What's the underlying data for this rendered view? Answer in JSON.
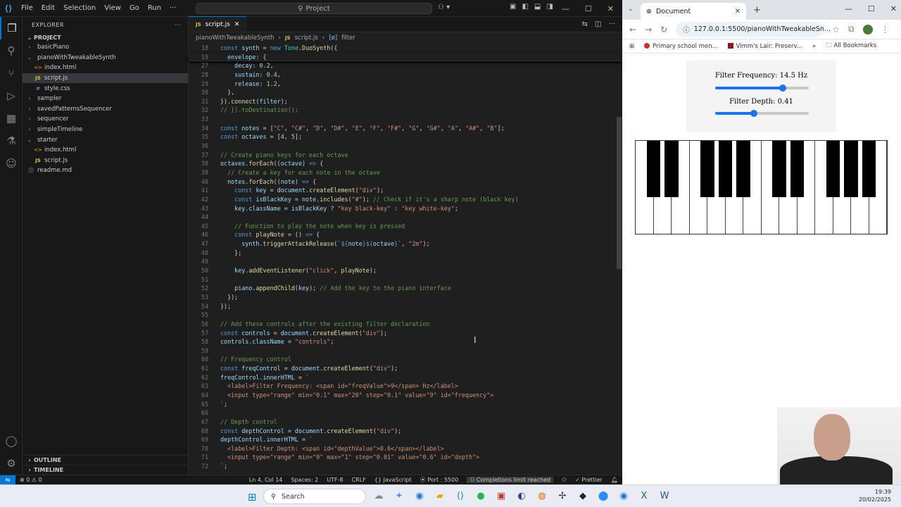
{
  "vscode": {
    "menu": [
      "File",
      "Edit",
      "Selection",
      "View",
      "Go",
      "Run",
      "···"
    ],
    "command_center": "Project",
    "explorer_title": "EXPLORER",
    "project_label": "PROJECT",
    "tree": [
      {
        "label": "basicPiano",
        "type": "folder",
        "depth": 1
      },
      {
        "label": "pianoWithTweakableSynth",
        "type": "folder-open",
        "depth": 1
      },
      {
        "label": "index.html",
        "type": "html",
        "depth": 2
      },
      {
        "label": "script.js",
        "type": "js",
        "depth": 2
      },
      {
        "label": "style.css",
        "type": "css",
        "depth": 2
      },
      {
        "label": "sampler",
        "type": "folder",
        "depth": 1
      },
      {
        "label": "savedPatternsSequencer",
        "type": "folder",
        "depth": 1
      },
      {
        "label": "sequencer",
        "type": "folder",
        "depth": 1
      },
      {
        "label": "simpleTimeline",
        "type": "folder",
        "depth": 1
      },
      {
        "label": "starter",
        "type": "folder-open",
        "depth": 1
      },
      {
        "label": "index.html",
        "type": "html",
        "depth": 2
      },
      {
        "label": "script.js",
        "type": "js",
        "depth": 2
      },
      {
        "label": "readme.md",
        "type": "md",
        "depth": 1
      }
    ],
    "outline_label": "OUTLINE",
    "timeline_label": "TIMELINE",
    "tab_label": "script.js",
    "breadcrumb": [
      "pianoWithTweakableSynth",
      "script.js",
      "filter"
    ],
    "code_lines": [
      {
        "n": "18",
        "html": "<span class='k'>const</span> <span class='v'>synth</span> = <span class='k'>new</span> <span class='cl'>Tone</span>.<span class='f'>DuoSynth</span>({",
        "sticky": true
      },
      {
        "n": "19",
        "html": "  <span class='v'>envelope</span>: {",
        "sticky": true
      },
      {
        "n": "27",
        "html": "    <span class='v'>decay</span>: <span class='n'>0.2</span>,"
      },
      {
        "n": "28",
        "html": "    <span class='v'>sustain</span>: <span class='n'>0.4</span>,"
      },
      {
        "n": "29",
        "html": "    <span class='v'>release</span>: <span class='n'>1.2</span>,"
      },
      {
        "n": "30",
        "html": "  },"
      },
      {
        "n": "31",
        "html": "}).<span class='f'>connect</span>(<span class='v'>filter</span>);"
      },
      {
        "n": "32",
        "html": "<span class='c'>// }).toDestination();</span>"
      },
      {
        "n": "33",
        "html": ""
      },
      {
        "n": "34",
        "html": "<span class='k'>const</span> <span class='v'>notes</span> = [<span class='s'>\"C\"</span>, <span class='s'>\"C#\"</span>, <span class='s'>\"D\"</span>, <span class='s'>\"D#\"</span>, <span class='s'>\"E\"</span>, <span class='s'>\"F\"</span>, <span class='s'>\"F#\"</span>, <span class='s'>\"G\"</span>, <span class='s'>\"G#\"</span>, <span class='s'>\"A\"</span>, <span class='s'>\"A#\"</span>, <span class='s'>\"B\"</span>];"
      },
      {
        "n": "35",
        "html": "<span class='k'>const</span> <span class='v'>octaves</span> = [<span class='n'>4</span>, <span class='n'>5</span>];"
      },
      {
        "n": "36",
        "html": ""
      },
      {
        "n": "37",
        "html": "<span class='c'>// Create piano keys for each octave</span>"
      },
      {
        "n": "38",
        "html": "<span class='v'>octaves</span>.<span class='f'>forEach</span>((<span class='v'>octave</span>) <span class='k'>=&gt;</span> {"
      },
      {
        "n": "39",
        "html": "  <span class='c'>// Create a key for each note in the octave</span>"
      },
      {
        "n": "40",
        "html": "  <span class='v'>notes</span>.<span class='f'>forEach</span>((<span class='v'>note</span>) <span class='k'>=&gt;</span> {"
      },
      {
        "n": "41",
        "html": "    <span class='k'>const</span> <span class='v'>key</span> = <span class='v'>document</span>.<span class='f'>createElement</span>(<span class='s'>\"div\"</span>);"
      },
      {
        "n": "42",
        "html": "    <span class='k'>const</span> <span class='v'>isBlackKey</span> = <span class='v'>note</span>.<span class='f'>includes</span>(<span class='s'>\"#\"</span>); <span class='c'>// Check if it's a sharp note (black key)</span>"
      },
      {
        "n": "43",
        "html": "    <span class='v'>key</span>.<span class='v'>className</span> = <span class='v'>isBlackKey</span> ? <span class='s'>\"key black-key\"</span> : <span class='s'>\"key white-key\"</span>;"
      },
      {
        "n": "44",
        "html": ""
      },
      {
        "n": "45",
        "html": "    <span class='c'>// Function to play the note when key is pressed</span>"
      },
      {
        "n": "46",
        "html": "    <span class='k'>const</span> <span class='f'>playNote</span> = () <span class='k'>=&gt;</span> {"
      },
      {
        "n": "47",
        "html": "      <span class='v'>synth</span>.<span class='f'>triggerAttackRelease</span>(<span class='s'>`</span><span class='k'>${</span><span class='v'>note</span><span class='k'>}${</span><span class='v'>octave</span><span class='k'>}</span><span class='s'>`</span>, <span class='s'>\"2m\"</span>);"
      },
      {
        "n": "48",
        "html": "    };"
      },
      {
        "n": "49",
        "html": ""
      },
      {
        "n": "50",
        "html": "    <span class='v'>key</span>.<span class='f'>addEventListener</span>(<span class='s'>\"click\"</span>, <span class='f'>playNote</span>);"
      },
      {
        "n": "51",
        "html": ""
      },
      {
        "n": "52",
        "html": "    <span class='v'>piano</span>.<span class='f'>appendChild</span>(<span class='v'>key</span>); <span class='c'>// Add the key to the piano interface</span>"
      },
      {
        "n": "53",
        "html": "  });"
      },
      {
        "n": "54",
        "html": "});"
      },
      {
        "n": "55",
        "html": ""
      },
      {
        "n": "56",
        "html": "<span class='c'>// Add these controls after the existing filter declaration</span>"
      },
      {
        "n": "57",
        "html": "<span class='k'>const</span> <span class='v'>controls</span> = <span class='v'>document</span>.<span class='f'>createElement</span>(<span class='s'>\"div\"</span>);"
      },
      {
        "n": "58",
        "html": "<span class='v'>controls</span>.<span class='v'>className</span> = <span class='s'>\"controls\"</span>;"
      },
      {
        "n": "59",
        "html": ""
      },
      {
        "n": "60",
        "html": "<span class='c'>// Frequency control</span>"
      },
      {
        "n": "61",
        "html": "<span class='k'>const</span> <span class='v'>freqControl</span> = <span class='v'>document</span>.<span class='f'>createElement</span>(<span class='s'>\"div\"</span>);"
      },
      {
        "n": "62",
        "html": "<span class='v'>freqControl</span>.<span class='v'>innerHTML</span> = <span class='s'>`</span>"
      },
      {
        "n": "63",
        "html": "<span class='s'>  &lt;label&gt;Filter Frequency: &lt;span id=\"freqValue\"&gt;9&lt;/span&gt; Hz&lt;/label&gt;</span>"
      },
      {
        "n": "64",
        "html": "<span class='s'>  &lt;input type=\"range\" min=\"0.1\" max=\"20\" step=\"0.1\" value=\"9\" id=\"frequency\"&gt;</span>"
      },
      {
        "n": "65",
        "html": "<span class='s'>`</span>;"
      },
      {
        "n": "66",
        "html": ""
      },
      {
        "n": "67",
        "html": "<span class='c'>// Depth control</span>"
      },
      {
        "n": "68",
        "html": "<span class='k'>const</span> <span class='v'>depthControl</span> = <span class='v'>document</span>.<span class='f'>createElement</span>(<span class='s'>\"div\"</span>);"
      },
      {
        "n": "69",
        "html": "<span class='v'>depthControl</span>.<span class='v'>innerHTML</span> = <span class='s'>`</span>"
      },
      {
        "n": "70",
        "html": "<span class='s'>  &lt;label&gt;Filter Depth: &lt;span id=\"depthValue\"&gt;0.6&lt;/span&gt;&lt;/label&gt;</span>"
      },
      {
        "n": "71",
        "html": "<span class='s'>  &lt;input type=\"range\" min=\"0\" max=\"1\" step=\"0.01\" value=\"0.6\" id=\"depth\"&gt;</span>"
      },
      {
        "n": "72",
        "html": "<span class='s'>`</span>;"
      }
    ],
    "status": {
      "errors": "⊗ 0 ⚠ 0",
      "position": "Ln 4, Col 14",
      "spaces": "Spaces: 2",
      "encoding": "UTF-8",
      "eol": "CRLF",
      "language": "JavaScript",
      "port": "Port : 5500",
      "completions": "Completions limit reached",
      "prettier": "Prettier"
    }
  },
  "browser": {
    "tab_title": "Document",
    "url": "127.0.0.1:5500/pianoWithTweakableSn...",
    "bookmarks": [
      "Primary school men...",
      "Vimm's Lair: Preserv..."
    ],
    "all_bookmarks": "All Bookmarks",
    "freq_label": "Filter Frequency: ",
    "freq_value": "14.5",
    "freq_unit": " Hz",
    "freq_slider_fraction": 0.72,
    "depth_label": "Filter Depth: ",
    "depth_value": "0.41",
    "depth_slider_fraction": 0.41,
    "accent_color": "#1a73e8",
    "piano_white_keys": 14,
    "piano_black_keys": 10
  },
  "taskbar": {
    "search_label": "Search",
    "time": "19:39",
    "date": "20/02/2025"
  }
}
